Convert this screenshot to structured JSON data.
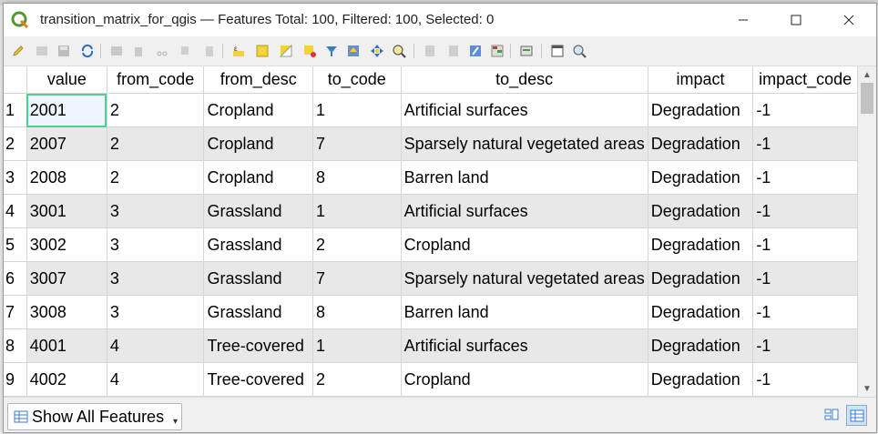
{
  "window": {
    "title": "transition_matrix_for_qgis — Features Total: 100, Filtered: 100, Selected: 0",
    "controls": {
      "minimize": "—",
      "maximize": "☐",
      "close": "✕"
    }
  },
  "toolbar": {
    "icons": [
      "pencil-icon",
      "multi-edit-icon",
      "save-icon",
      "refresh-icon",
      "add-feature-icon",
      "delete-feature-icon",
      "cut-icon",
      "copy-icon",
      "paste-icon",
      "select-expression-icon",
      "select-all-icon",
      "invert-selection-icon",
      "deselect-icon",
      "filter-icon",
      "move-top-icon",
      "pan-selection-icon",
      "zoom-selection-icon",
      "new-field-icon",
      "delete-field-icon",
      "field-calculator-icon",
      "conditional-format-icon",
      "actions-icon",
      "dock-icon",
      "organize-columns-icon"
    ]
  },
  "table": {
    "columns": [
      "value",
      "from_code",
      "from_desc",
      "to_code",
      "to_desc",
      "impact",
      "impact_code"
    ],
    "rows": [
      {
        "n": "1",
        "cells": [
          "2001",
          "2",
          "Cropland",
          "1",
          "Artificial surfaces",
          "Degradation",
          "-1"
        ]
      },
      {
        "n": "2",
        "cells": [
          "2007",
          "2",
          "Cropland",
          "7",
          "Sparsely natural vegetated areas",
          "Degradation",
          "-1"
        ]
      },
      {
        "n": "3",
        "cells": [
          "2008",
          "2",
          "Cropland",
          "8",
          "Barren land",
          "Degradation",
          "-1"
        ]
      },
      {
        "n": "4",
        "cells": [
          "3001",
          "3",
          "Grassland",
          "1",
          "Artificial surfaces",
          "Degradation",
          "-1"
        ]
      },
      {
        "n": "5",
        "cells": [
          "3002",
          "3",
          "Grassland",
          "2",
          "Cropland",
          "Degradation",
          "-1"
        ]
      },
      {
        "n": "6",
        "cells": [
          "3007",
          "3",
          "Grassland",
          "7",
          "Sparsely natural vegetated areas",
          "Degradation",
          "-1"
        ]
      },
      {
        "n": "7",
        "cells": [
          "3008",
          "3",
          "Grassland",
          "8",
          "Barren land",
          "Degradation",
          "-1"
        ]
      },
      {
        "n": "8",
        "cells": [
          "4001",
          "4",
          "Tree-covered",
          "1",
          "Artificial surfaces",
          "Degradation",
          "-1"
        ]
      },
      {
        "n": "9",
        "cells": [
          "4002",
          "4",
          "Tree-covered",
          "2",
          "Cropland",
          "Degradation",
          "-1"
        ]
      }
    ]
  },
  "status": {
    "show_all_label": "Show All Features",
    "caret": "▾"
  },
  "colors": {
    "selection_outline": "#4fd08f",
    "alt_row": "#e8e8e8",
    "view_toggle_active": "#cfe3f7"
  }
}
